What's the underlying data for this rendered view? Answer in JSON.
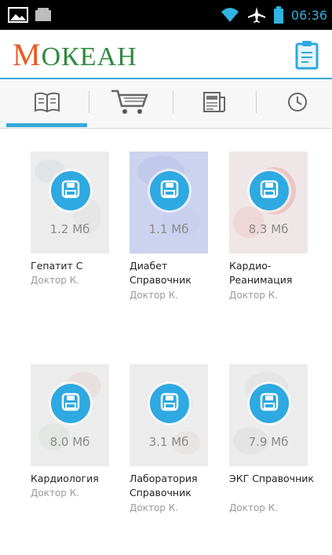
{
  "status_bar": {
    "time": "06:36",
    "icons": [
      "picture-icon",
      "sd-card-icon",
      "wifi-icon",
      "airplane-icon",
      "battery-icon"
    ]
  },
  "header": {
    "logo_first": "М",
    "logo_rest": "ОКЕАН",
    "action_icon": "clipboard-icon"
  },
  "tabs": [
    {
      "icon": "book-icon",
      "selected": true
    },
    {
      "icon": "cart-icon",
      "selected": false
    },
    {
      "icon": "news-icon",
      "selected": false
    },
    {
      "icon": "clock-icon",
      "selected": false
    }
  ],
  "books": [
    {
      "size": "1.2 Мб",
      "title": "Гепатит С",
      "author": "Доктор К."
    },
    {
      "size": "1.1 Мб",
      "title": "Диабет Справочник",
      "author": "Доктор К."
    },
    {
      "size": "8.3 Мб",
      "title": "Кардио-Реанимация",
      "author": "Доктор К."
    },
    {
      "size": "8.0 Мб",
      "title": "Кардиология",
      "author": "Доктор К."
    },
    {
      "size": "3.1 Мб",
      "title": "Лаборатория Справочник",
      "author": "Доктор К."
    },
    {
      "size": "7.9 Мб",
      "title": "ЭКГ Справочник",
      "author": "Доктор К."
    }
  ],
  "colors": {
    "accent": "#38a9d8",
    "download_button": "#2ea9e1",
    "logo_green": "#2f8a3f",
    "logo_orange": "#e85b22"
  }
}
